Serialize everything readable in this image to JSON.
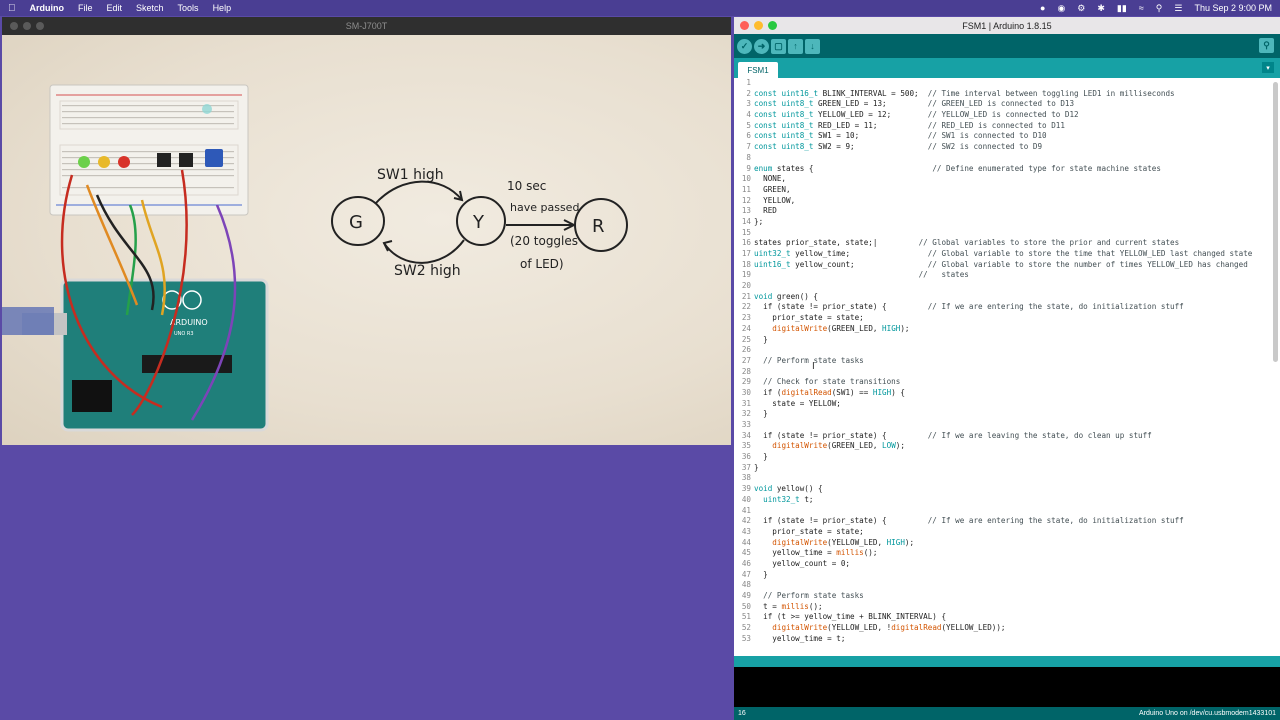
{
  "menubar": {
    "apple": "",
    "app": "Arduino",
    "items": [
      "File",
      "Edit",
      "Sketch",
      "Tools",
      "Help"
    ],
    "clock": "Thu Sep 2  9:00 PM"
  },
  "video": {
    "title": "SM-J700T",
    "diagram": {
      "state_g": "G",
      "state_y": "Y",
      "state_r": "R",
      "edge_sw1": "SW1 high",
      "edge_sw2": "SW2 high",
      "edge_timer_1": "10 sec",
      "edge_timer_2": "have passed",
      "edge_timer_3": "(20 toggles",
      "edge_timer_4": "of LED)"
    },
    "board_label": "ARDUINO",
    "board_sub": "UNO R3"
  },
  "ide": {
    "title": "FSM1 | Arduino 1.8.15",
    "tab": "FSM1",
    "tab_menu": "▾",
    "status_line": "16",
    "status_board": "Arduino Uno on /dev/cu.usbmodem1433101",
    "code_lines": [
      [
        {
          "t": "",
          "c": ""
        }
      ],
      [
        {
          "t": "const ",
          "c": "kw"
        },
        {
          "t": "uint16_t ",
          "c": "kw"
        },
        {
          "t": "BLINK_INTERVAL = 500;  ",
          "c": ""
        },
        {
          "t": "// Time interval between toggling LED1 in milliseconds",
          "c": "cm"
        }
      ],
      [
        {
          "t": "const ",
          "c": "kw"
        },
        {
          "t": "uint8_t ",
          "c": "kw"
        },
        {
          "t": "GREEN_LED = 13;         ",
          "c": ""
        },
        {
          "t": "// GREEN_LED is connected to D13",
          "c": "cm"
        }
      ],
      [
        {
          "t": "const ",
          "c": "kw"
        },
        {
          "t": "uint8_t ",
          "c": "kw"
        },
        {
          "t": "YELLOW_LED = 12;        ",
          "c": ""
        },
        {
          "t": "// YELLOW_LED is connected to D12",
          "c": "cm"
        }
      ],
      [
        {
          "t": "const ",
          "c": "kw"
        },
        {
          "t": "uint8_t ",
          "c": "kw"
        },
        {
          "t": "RED_LED = 11;           ",
          "c": ""
        },
        {
          "t": "// RED_LED is connected to D11",
          "c": "cm"
        }
      ],
      [
        {
          "t": "const ",
          "c": "kw"
        },
        {
          "t": "uint8_t ",
          "c": "kw"
        },
        {
          "t": "SW1 = 10;               ",
          "c": ""
        },
        {
          "t": "// SW1 is connected to D10",
          "c": "cm"
        }
      ],
      [
        {
          "t": "const ",
          "c": "kw"
        },
        {
          "t": "uint8_t ",
          "c": "kw"
        },
        {
          "t": "SW2 = 9;                ",
          "c": ""
        },
        {
          "t": "// SW2 is connected to D9",
          "c": "cm"
        }
      ],
      [
        {
          "t": "",
          "c": ""
        }
      ],
      [
        {
          "t": "enum ",
          "c": "kw"
        },
        {
          "t": "states {                          ",
          "c": ""
        },
        {
          "t": "// Define enumerated type for state machine states",
          "c": "cm"
        }
      ],
      [
        {
          "t": "  NONE,",
          "c": ""
        }
      ],
      [
        {
          "t": "  GREEN,",
          "c": ""
        }
      ],
      [
        {
          "t": "  YELLOW,",
          "c": ""
        }
      ],
      [
        {
          "t": "  RED",
          "c": ""
        }
      ],
      [
        {
          "t": "};",
          "c": ""
        }
      ],
      [
        {
          "t": "",
          "c": ""
        }
      ],
      [
        {
          "t": "states prior_state, state;|         ",
          "c": ""
        },
        {
          "t": "// Global variables to store the prior and current states",
          "c": "cm"
        }
      ],
      [
        {
          "t": "uint32_t ",
          "c": "kw"
        },
        {
          "t": "yellow_time;                 ",
          "c": ""
        },
        {
          "t": "// Global variable to store the time that YELLOW_LED last changed state",
          "c": "cm"
        }
      ],
      [
        {
          "t": "uint16_t ",
          "c": "kw"
        },
        {
          "t": "yellow_count;                ",
          "c": ""
        },
        {
          "t": "// Global variable to store the number of times YELLOW_LED has changed",
          "c": "cm"
        }
      ],
      [
        {
          "t": "                                    ",
          "c": ""
        },
        {
          "t": "//   states",
          "c": "cm"
        }
      ],
      [
        {
          "t": "",
          "c": ""
        }
      ],
      [
        {
          "t": "void ",
          "c": "kw"
        },
        {
          "t": "green() {",
          "c": ""
        }
      ],
      [
        {
          "t": "  if (state != prior_state) {         ",
          "c": ""
        },
        {
          "t": "// If we are entering the state, do initialization stuff",
          "c": "cm"
        }
      ],
      [
        {
          "t": "    prior_state = state;",
          "c": ""
        }
      ],
      [
        {
          "t": "    ",
          "c": ""
        },
        {
          "t": "digitalWrite",
          "c": "fn"
        },
        {
          "t": "(GREEN_LED, ",
          "c": ""
        },
        {
          "t": "HIGH",
          "c": "cst"
        },
        {
          "t": ");",
          "c": ""
        }
      ],
      [
        {
          "t": "  }",
          "c": ""
        }
      ],
      [
        {
          "t": "",
          "c": ""
        }
      ],
      [
        {
          "t": "  ",
          "c": ""
        },
        {
          "t": "// Perform state tasks",
          "c": "cm"
        }
      ],
      [
        {
          "t": "",
          "c": ""
        }
      ],
      [
        {
          "t": "  ",
          "c": ""
        },
        {
          "t": "// Check for state transitions",
          "c": "cm"
        }
      ],
      [
        {
          "t": "  if (",
          "c": ""
        },
        {
          "t": "digitalRead",
          "c": "fn"
        },
        {
          "t": "(SW1) == ",
          "c": ""
        },
        {
          "t": "HIGH",
          "c": "cst"
        },
        {
          "t": ") {",
          "c": ""
        }
      ],
      [
        {
          "t": "    state = YELLOW;",
          "c": ""
        }
      ],
      [
        {
          "t": "  }",
          "c": ""
        }
      ],
      [
        {
          "t": "",
          "c": ""
        }
      ],
      [
        {
          "t": "  if (state != prior_state) {         ",
          "c": ""
        },
        {
          "t": "// If we are leaving the state, do clean up stuff",
          "c": "cm"
        }
      ],
      [
        {
          "t": "    ",
          "c": ""
        },
        {
          "t": "digitalWrite",
          "c": "fn"
        },
        {
          "t": "(GREEN_LED, ",
          "c": ""
        },
        {
          "t": "LOW",
          "c": "cst"
        },
        {
          "t": ");",
          "c": ""
        }
      ],
      [
        {
          "t": "  }",
          "c": ""
        }
      ],
      [
        {
          "t": "}",
          "c": ""
        }
      ],
      [
        {
          "t": "",
          "c": ""
        }
      ],
      [
        {
          "t": "void ",
          "c": "kw"
        },
        {
          "t": "yellow() {",
          "c": ""
        }
      ],
      [
        {
          "t": "  ",
          "c": ""
        },
        {
          "t": "uint32_t ",
          "c": "kw"
        },
        {
          "t": "t;",
          "c": ""
        }
      ],
      [
        {
          "t": "",
          "c": ""
        }
      ],
      [
        {
          "t": "  if (state != prior_state) {         ",
          "c": ""
        },
        {
          "t": "// If we are entering the state, do initialization stuff",
          "c": "cm"
        }
      ],
      [
        {
          "t": "    prior_state = state;",
          "c": ""
        }
      ],
      [
        {
          "t": "    ",
          "c": ""
        },
        {
          "t": "digitalWrite",
          "c": "fn"
        },
        {
          "t": "(YELLOW_LED, ",
          "c": ""
        },
        {
          "t": "HIGH",
          "c": "cst"
        },
        {
          "t": ");",
          "c": ""
        }
      ],
      [
        {
          "t": "    yellow_time = ",
          "c": ""
        },
        {
          "t": "millis",
          "c": "fn"
        },
        {
          "t": "();",
          "c": ""
        }
      ],
      [
        {
          "t": "    yellow_count = 0;",
          "c": ""
        }
      ],
      [
        {
          "t": "  }",
          "c": ""
        }
      ],
      [
        {
          "t": "",
          "c": ""
        }
      ],
      [
        {
          "t": "  ",
          "c": ""
        },
        {
          "t": "// Perform state tasks",
          "c": "cm"
        }
      ],
      [
        {
          "t": "  t = ",
          "c": ""
        },
        {
          "t": "millis",
          "c": "fn"
        },
        {
          "t": "();",
          "c": ""
        }
      ],
      [
        {
          "t": "  if (t >= yellow_time + BLINK_INTERVAL) {",
          "c": ""
        }
      ],
      [
        {
          "t": "    ",
          "c": ""
        },
        {
          "t": "digitalWrite",
          "c": "fn"
        },
        {
          "t": "(YELLOW_LED, !",
          "c": ""
        },
        {
          "t": "digitalRead",
          "c": "fn"
        },
        {
          "t": "(YELLOW_LED));",
          "c": ""
        }
      ],
      [
        {
          "t": "    yellow_time = t;",
          "c": ""
        }
      ]
    ]
  }
}
